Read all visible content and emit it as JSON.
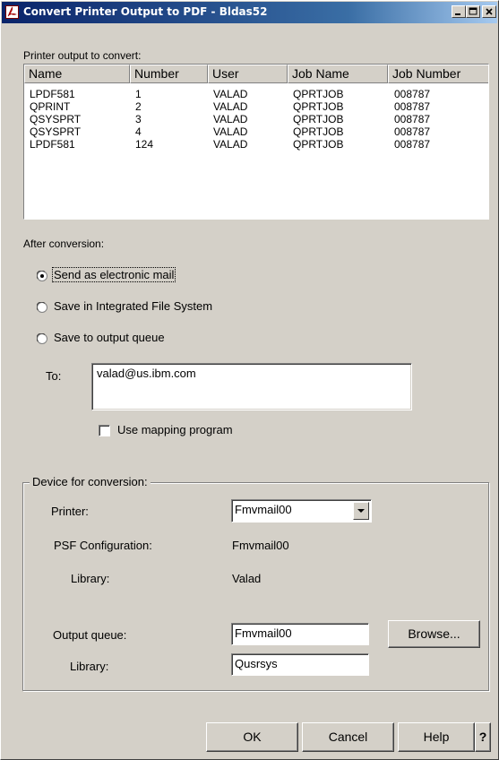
{
  "window": {
    "title": "Convert Printer Output to PDF - Bldas52",
    "app_icon": "pdf-icon",
    "controls": [
      "minimize-icon",
      "maximize-icon",
      "close-icon"
    ]
  },
  "printer_output": {
    "label": "Printer output to convert:",
    "columns": [
      "Name",
      "Number",
      "User",
      "Job Name",
      "Job Number"
    ],
    "rows": [
      [
        "LPDF581",
        "1",
        "VALAD",
        "QPRTJOB",
        "008787"
      ],
      [
        "QPRINT",
        "2",
        "VALAD",
        "QPRTJOB",
        "008787"
      ],
      [
        "QSYSPRT",
        "3",
        "VALAD",
        "QPRTJOB",
        "008787"
      ],
      [
        "QSYSPRT",
        "4",
        "VALAD",
        "QPRTJOB",
        "008787"
      ],
      [
        "LPDF581",
        "124",
        "VALAD",
        "QPRTJOB",
        "008787"
      ]
    ]
  },
  "after_conversion": {
    "label": "After conversion:",
    "options": [
      {
        "label": "Send as electronic mail",
        "selected": true
      },
      {
        "label": "Save in Integrated File System",
        "selected": false
      },
      {
        "label": "Save to output queue",
        "selected": false
      }
    ],
    "to_label": "To:",
    "to_value": "valad@us.ibm.com",
    "mapping_label": "Use mapping program",
    "mapping_checked": false
  },
  "device": {
    "title": "Device for conversion:",
    "printer_label": "Printer:",
    "printer_value": "Fmvmail00",
    "psf_label": "PSF Configuration:",
    "psf_value": "Fmvmail00",
    "psf_library_label": "Library:",
    "psf_library_value": "Valad",
    "outq_label": "Output queue:",
    "outq_value": "Fmvmail00",
    "browse_label": "Browse...",
    "outq_library_label": "Library:",
    "outq_library_value": "Qusrsys"
  },
  "buttons": {
    "ok": "OK",
    "cancel": "Cancel",
    "help": "Help",
    "whats_this": "?"
  }
}
